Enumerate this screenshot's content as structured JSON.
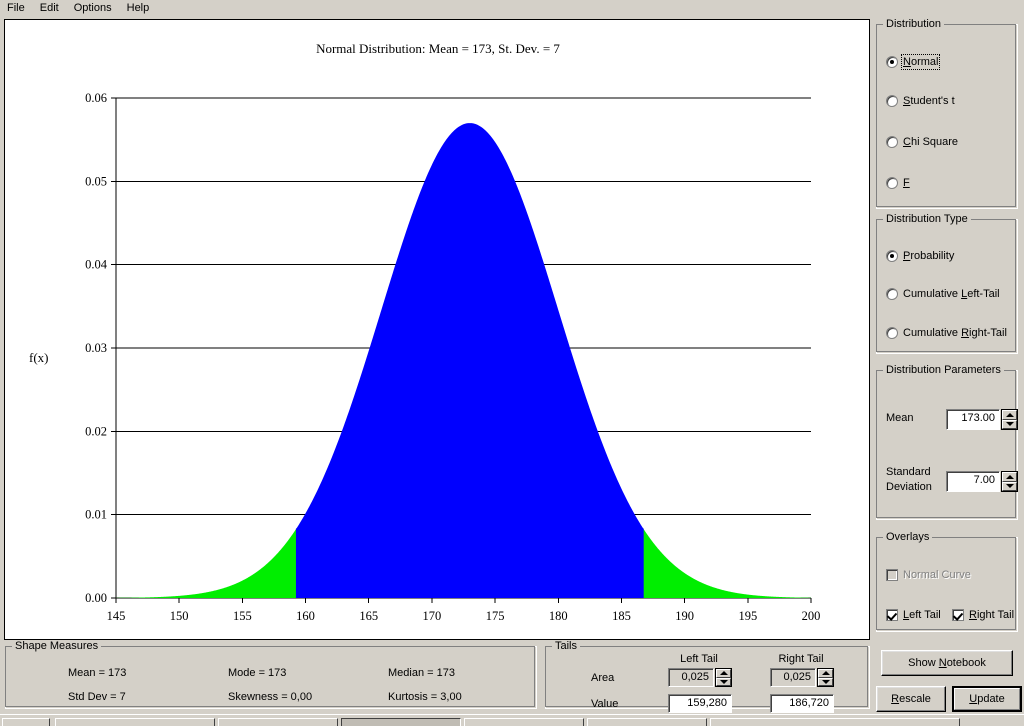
{
  "menu": {
    "items": [
      {
        "label": "File"
      },
      {
        "label": "Edit"
      },
      {
        "label": "Options"
      },
      {
        "label": "Help"
      }
    ]
  },
  "chart_data": {
    "type": "area",
    "title": "Normal Distribution: Mean = 173, St. Dev. = 7",
    "xlabel": "",
    "ylabel": "f(x)",
    "xlim": [
      145,
      200
    ],
    "ylim": [
      0.0,
      0.06
    ],
    "xticks": [
      "145",
      "150",
      "155",
      "160",
      "165",
      "170",
      "175",
      "180",
      "185",
      "190",
      "195",
      "200"
    ],
    "xtick_values": [
      145,
      150,
      155,
      160,
      165,
      170,
      175,
      180,
      185,
      190,
      195,
      200
    ],
    "yticks": [
      "0.00",
      "0.01",
      "0.02",
      "0.03",
      "0.04",
      "0.05",
      "0.06"
    ],
    "ytick_values": [
      0.0,
      0.01,
      0.02,
      0.03,
      0.04,
      0.05,
      0.06
    ],
    "grid": true,
    "legend": "none",
    "distribution": "normal",
    "mean": 173,
    "std_dev": 7,
    "peak_value": 0.05699,
    "fill_center_color": "#0000ff",
    "fill_tail_color": "#00ee00",
    "left_tail_cutoff": 159.28,
    "right_tail_cutoff": 186.72,
    "left_tail_area": 0.025,
    "right_tail_area": 0.025
  },
  "distribution": {
    "group_label": "Distribution",
    "options": [
      {
        "label": "Normal",
        "mnemonic": "N",
        "selected": true,
        "focused": true
      },
      {
        "label": "Student's t",
        "mnemonic": "S",
        "selected": false,
        "focused": false
      },
      {
        "label": "Chi Square",
        "mnemonic": "C",
        "selected": false,
        "focused": false
      },
      {
        "label": "F",
        "mnemonic": "F",
        "selected": false,
        "focused": false
      }
    ]
  },
  "distribution_type": {
    "group_label": "Distribution Type",
    "options": [
      {
        "label": "Probability",
        "mnemonic": "P",
        "selected": true
      },
      {
        "label": "Cumulative Left-Tail",
        "mnemonic": "L",
        "selected": false
      },
      {
        "label": "Cumulative Right-Tail",
        "mnemonic": "R",
        "selected": false
      }
    ]
  },
  "parameters": {
    "group_label": "Distribution Parameters",
    "mean_label": "Mean",
    "mean_value": "173.00",
    "std_label_line1": "Standard",
    "std_label_line2": "Deviation",
    "std_value": "7.00"
  },
  "overlays": {
    "group_label": "Overlays",
    "normal_curve": {
      "label": "Normal Curve",
      "checked": false,
      "enabled": false
    },
    "left_tail": {
      "label": "Left Tail",
      "mnemonic": "L",
      "checked": true,
      "enabled": true
    },
    "right_tail": {
      "label": "Right Tail",
      "mnemonic": "R",
      "checked": true,
      "enabled": true
    }
  },
  "actions": {
    "show_notebook": "Show Notebook",
    "rescale": "Rescale",
    "update": "Update"
  },
  "shape_measures": {
    "group_label": "Shape Measures",
    "cells": [
      {
        "label": "Mean = 173"
      },
      {
        "label": "Mode = 173"
      },
      {
        "label": "Median = 173"
      },
      {
        "label": "Std Dev = 7"
      },
      {
        "label": "Skewness = 0,00"
      },
      {
        "label": "Kurtosis = 3,00"
      }
    ]
  },
  "tails": {
    "group_label": "Tails",
    "left_header": "Left Tail",
    "right_header": "Right Tail",
    "area_label": "Area",
    "value_label": "Value",
    "left_area": "0,025",
    "right_area": "0,025",
    "left_value": "159,280",
    "right_value": "186,720"
  }
}
